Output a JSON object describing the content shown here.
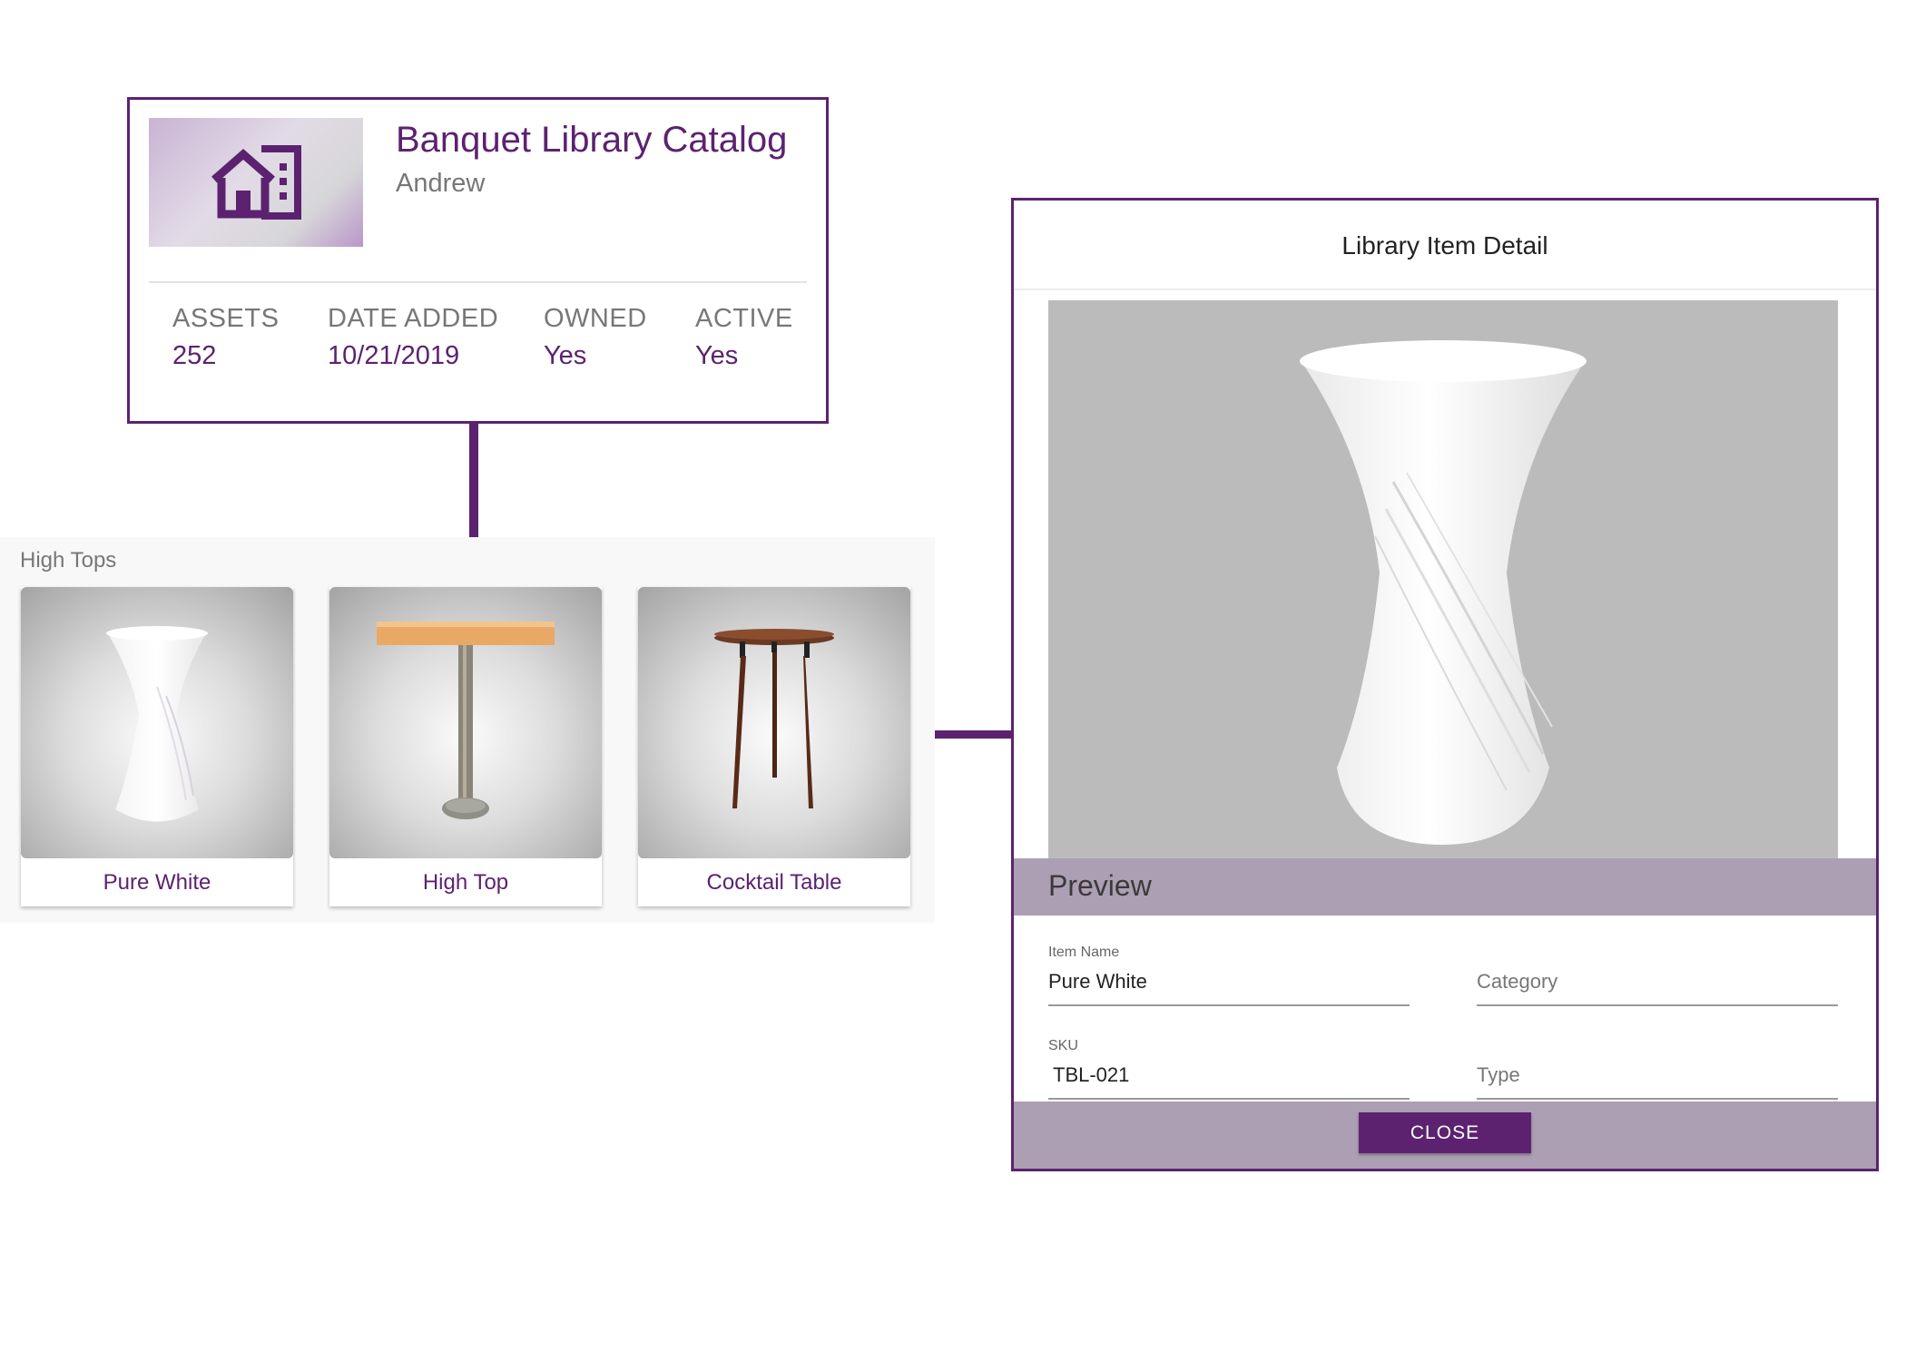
{
  "catalog": {
    "title": "Banquet Library Catalog",
    "owner": "Andrew",
    "icon": "building-icon",
    "stats": [
      {
        "label": "ASSETS",
        "value": "252"
      },
      {
        "label": "DATE ADDED",
        "value": "10/21/2019"
      },
      {
        "label": "OWNED",
        "value": "Yes"
      },
      {
        "label": "ACTIVE",
        "value": "Yes"
      }
    ]
  },
  "gallery": {
    "title": "High Tops",
    "items": [
      {
        "label": "Pure White",
        "image": "twisted-white-table"
      },
      {
        "label": "High Top",
        "image": "square-wood-high-top-table"
      },
      {
        "label": "Cocktail Table",
        "image": "round-wood-cocktail-table"
      }
    ]
  },
  "detail": {
    "title": "Library Item Detail",
    "preview_label": "Preview",
    "fields": {
      "item_name": {
        "label": "Item Name",
        "value": "Pure White"
      },
      "category": {
        "placeholder": "Category"
      },
      "sku": {
        "label": "SKU",
        "value": "TBL-021"
      },
      "type": {
        "placeholder": "Type"
      }
    },
    "close_label": "CLOSE"
  },
  "colors": {
    "accent": "#5c2270",
    "bar": "#ad9fb3",
    "preview_bg": "#bbbbbb"
  }
}
